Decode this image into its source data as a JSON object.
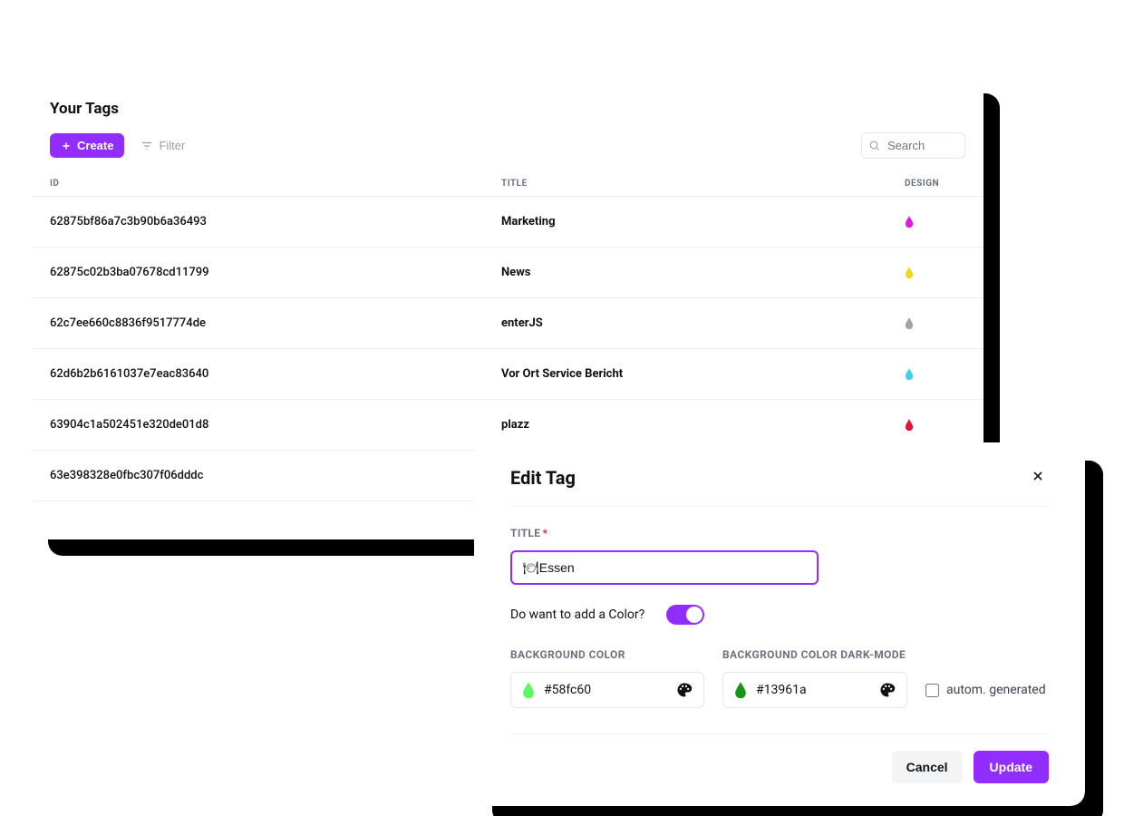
{
  "page": {
    "title": "Your Tags",
    "create_label": "Create",
    "filter_label": "Filter",
    "search_placeholder": "Search"
  },
  "columns": {
    "id": "ID",
    "title": "TITLE",
    "design": "DESIGN"
  },
  "rows": [
    {
      "id": "62875bf86a7c3b90b6a36493",
      "title": "Marketing",
      "color": "#e516e5"
    },
    {
      "id": "62875c02b3ba07678cd11799",
      "title": "News",
      "color": "#eadb1a"
    },
    {
      "id": "62c7ee660c8836f9517774de",
      "title": "enterJS",
      "color": "#ad9ea5"
    },
    {
      "id": "62d6b2b6161037e7eac83640",
      "title": "Vor Ort Service Bericht",
      "color": "#3fd2e6"
    },
    {
      "id": "63904c1a502451e320de01d8",
      "title": "plazz",
      "color": "#e0163f"
    },
    {
      "id": "63e398328e0fbc307f06dddc",
      "title": "",
      "color": ""
    }
  ],
  "modal": {
    "title": "Edit Tag",
    "title_label": "TITLE",
    "title_value": "🍽Essen",
    "color_question": "Do want to add a Color?",
    "bg_label": "BACKGROUND COLOR",
    "bg_dark_label": "BACKGROUND COLOR DARK-MODE",
    "bg_value": "#58fc60",
    "bg_dark_value": "#13961a",
    "autogen_label": "autom. generated",
    "cancel_label": "Cancel",
    "update_label": "Update"
  },
  "colors": {
    "bg": "#58fc60",
    "bg_dark": "#13961a"
  }
}
